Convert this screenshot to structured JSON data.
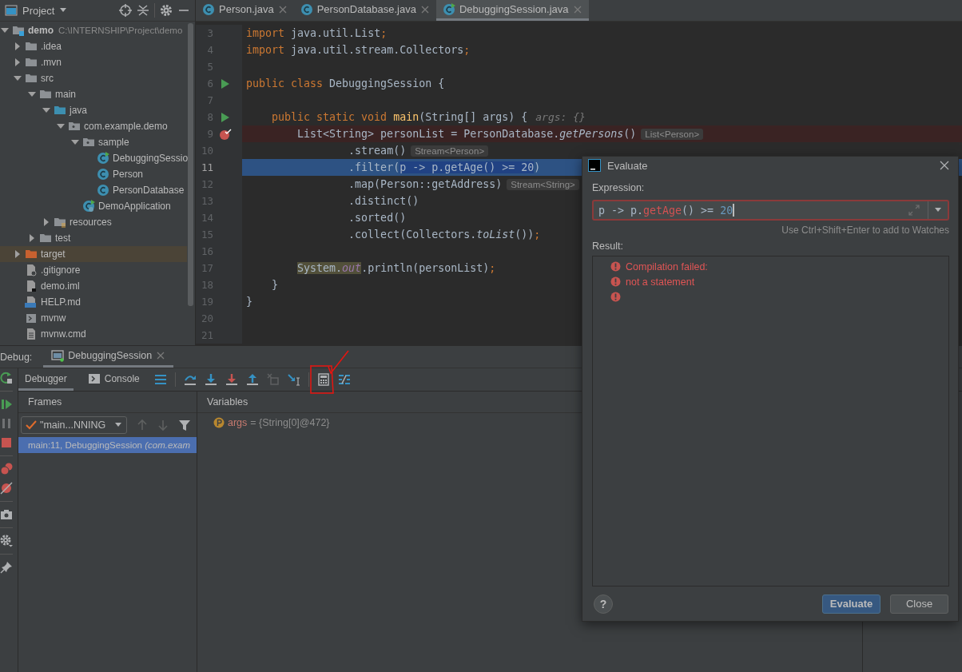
{
  "project_panel": {
    "title": "Project",
    "tree": [
      {
        "name": "demo",
        "path": "C:\\INTERNSHIP\\Project\\demo",
        "kind": "module",
        "expanded": true,
        "selected": false,
        "children": [
          {
            "name": ".idea",
            "kind": "folder",
            "expanded": false,
            "selected": false
          },
          {
            "name": ".mvn",
            "kind": "folder",
            "expanded": false,
            "selected": false
          },
          {
            "name": "src",
            "kind": "folder",
            "expanded": true,
            "selected": false,
            "children": [
              {
                "name": "main",
                "kind": "folder",
                "expanded": true,
                "selected": false,
                "children": [
                  {
                    "name": "java",
                    "kind": "source",
                    "expanded": true,
                    "selected": false,
                    "children": [
                      {
                        "name": "com.example.demo",
                        "kind": "package",
                        "expanded": true,
                        "selected": false,
                        "children": [
                          {
                            "name": "sample",
                            "kind": "package",
                            "expanded": true,
                            "selected": false,
                            "children": [
                              {
                                "name": "DebuggingSessio",
                                "kind": "class-main",
                                "selected": false
                              },
                              {
                                "name": "Person",
                                "kind": "class",
                                "selected": false
                              },
                              {
                                "name": "PersonDatabase",
                                "kind": "class",
                                "selected": false
                              }
                            ]
                          },
                          {
                            "name": "DemoApplication",
                            "kind": "spring",
                            "selected": false
                          }
                        ]
                      }
                    ]
                  },
                  {
                    "name": "resources",
                    "kind": "resources",
                    "expanded": false,
                    "selected": false
                  }
                ]
              },
              {
                "name": "test",
                "kind": "folder",
                "expanded": false,
                "selected": false
              }
            ]
          },
          {
            "name": "target",
            "kind": "excluded",
            "expanded": false,
            "selected": true
          },
          {
            "name": ".gitignore",
            "kind": "ignore",
            "selected": false
          },
          {
            "name": "demo.iml",
            "kind": "iml",
            "selected": false
          },
          {
            "name": "HELP.md",
            "kind": "md",
            "selected": false
          },
          {
            "name": "mvnw",
            "kind": "script",
            "selected": false
          },
          {
            "name": "mvnw.cmd",
            "kind": "text",
            "selected": false
          }
        ]
      }
    ]
  },
  "editor": {
    "tabs": [
      {
        "label": "Person.java",
        "kind": "class",
        "selected": false
      },
      {
        "label": "PersonDatabase.java",
        "kind": "class",
        "selected": false
      },
      {
        "label": "DebuggingSession.java",
        "kind": "class-main",
        "selected": true
      }
    ],
    "lines": [
      {
        "number": "3",
        "tokens": [
          {
            "text": "import",
            "kind": "kw"
          },
          {
            "text": " java.util.List",
            "kind": "p"
          },
          {
            "text": ";",
            "kind": "kw"
          }
        ]
      },
      {
        "number": "4",
        "tokens": [
          {
            "text": "import",
            "kind": "kw"
          },
          {
            "text": " java.util.stream.Collectors",
            "kind": "p"
          },
          {
            "text": ";",
            "kind": "kw"
          }
        ]
      },
      {
        "number": "5"
      },
      {
        "number": "6",
        "marker": {
          "kind": "run"
        },
        "tokens": [
          {
            "text": "public class ",
            "kind": "kw"
          },
          {
            "text": "DebuggingSession {",
            "kind": "p"
          }
        ]
      },
      {
        "number": "7"
      },
      {
        "number": "8",
        "marker": {
          "kind": "run"
        },
        "tokens": [
          {
            "text": "    public static void ",
            "kind": "kw"
          },
          {
            "text": "main",
            "kind": "fn"
          },
          {
            "text": "(String[] args) {",
            "kind": "p"
          }
        ],
        "hint": {
          "text": "args: {}",
          "kind": "value"
        }
      },
      {
        "number": "9",
        "marker": {
          "kind": "breakpoint"
        },
        "highlight": {
          "kind": "breakpoint"
        },
        "tokens": [
          {
            "text": "        List<String> personList = PersonDatabase.",
            "kind": "p"
          },
          {
            "text": "getPersons",
            "kind": "it"
          },
          {
            "text": "()",
            "kind": "p"
          }
        ],
        "hint": {
          "text": "List<Person>",
          "kind": "type"
        }
      },
      {
        "number": "10",
        "tokens": [
          {
            "text": "                .stream()",
            "kind": "p"
          }
        ],
        "hint": {
          "text": "Stream<Person>",
          "kind": "type"
        }
      },
      {
        "number": "11",
        "highlight": {
          "kind": "execution"
        },
        "tokens": [
          {
            "text": "                .filter(",
            "kind": "p"
          },
          {
            "text": "p -> p.getAge() >= 20",
            "kind": "sel"
          },
          {
            "text": ")",
            "kind": "p"
          }
        ]
      },
      {
        "number": "12",
        "tokens": [
          {
            "text": "                .map(Person::getAddress)",
            "kind": "p"
          }
        ],
        "hint": {
          "text": "Stream<String>",
          "kind": "type"
        }
      },
      {
        "number": "13",
        "tokens": [
          {
            "text": "                .distinct()",
            "kind": "p"
          }
        ]
      },
      {
        "number": "14",
        "tokens": [
          {
            "text": "                .sorted()",
            "kind": "p"
          }
        ]
      },
      {
        "number": "15",
        "tokens": [
          {
            "text": "                .collect(Collectors.",
            "kind": "p"
          },
          {
            "text": "toList",
            "kind": "it"
          },
          {
            "text": "())",
            "kind": "p"
          },
          {
            "text": ";",
            "kind": "kw"
          }
        ]
      },
      {
        "number": "16"
      },
      {
        "number": "17",
        "tokens": [
          {
            "text": "        System.",
            "kind": "usage"
          },
          {
            "text": "out",
            "kind": "usagefield"
          },
          {
            "text": ".println(personList)",
            "kind": "p"
          },
          {
            "text": ";",
            "kind": "kw"
          }
        ]
      },
      {
        "number": "18",
        "tokens": [
          {
            "text": "    }",
            "kind": "p"
          }
        ]
      },
      {
        "number": "19",
        "tokens": [
          {
            "text": "}",
            "kind": "p"
          }
        ]
      },
      {
        "number": "20"
      },
      {
        "number": "21"
      }
    ]
  },
  "debug": {
    "label": "Debug:",
    "session_tab": {
      "label": "DebuggingSession",
      "selected": true
    },
    "side_actions": [
      {
        "kind": "rerun",
        "disabled": false
      },
      {
        "kind": "separator"
      },
      {
        "kind": "resume",
        "disabled": false
      },
      {
        "kind": "pause",
        "disabled": true
      },
      {
        "kind": "stop",
        "disabled": false
      },
      {
        "kind": "separator"
      },
      {
        "kind": "breakpoints",
        "disabled": false
      },
      {
        "kind": "mute",
        "disabled": false
      },
      {
        "kind": "separator"
      },
      {
        "kind": "camera",
        "disabled": false
      },
      {
        "kind": "separator"
      },
      {
        "kind": "settings",
        "disabled": false
      },
      {
        "kind": "separator"
      },
      {
        "kind": "pin",
        "disabled": false
      }
    ],
    "tabs": [
      {
        "label": "Debugger",
        "kind": "plain",
        "selected": true
      },
      {
        "label": "Console",
        "kind": "console",
        "selected": false
      }
    ],
    "actions": [
      {
        "kind": "menu",
        "disabled": false
      },
      {
        "kind": "separator"
      },
      {
        "kind": "step-over",
        "disabled": false
      },
      {
        "kind": "step-into",
        "disabled": false
      },
      {
        "kind": "force-step-into",
        "disabled": false
      },
      {
        "kind": "step-out",
        "disabled": false
      },
      {
        "kind": "drop-frame",
        "disabled": true
      },
      {
        "kind": "run-to-cursor",
        "disabled": false
      },
      {
        "kind": "separator"
      },
      {
        "kind": "evaluate",
        "disabled": false
      },
      {
        "kind": "trace",
        "disabled": false
      }
    ],
    "frames": {
      "title": "Frames",
      "thread": "\"main...NNING",
      "items": [
        {
          "text": "main:11, DebuggingSession *(com.exam*",
          "selected": true
        }
      ]
    },
    "variables": {
      "title": "Variables",
      "items": [
        {
          "name": "args",
          "value": "= {String[0]@472}"
        }
      ]
    }
  },
  "evaluate_dialog": {
    "title": "Evaluate",
    "expression_label": "Expression:",
    "expression": [
      {
        "text": "p -> p.",
        "kind": "p"
      },
      {
        "text": "getAge",
        "kind": "error"
      },
      {
        "text": "() >= ",
        "kind": "p"
      },
      {
        "text": "20",
        "kind": "num"
      }
    ],
    "watch_hint": "Use Ctrl+Shift+Enter to add to Watches",
    "result_label": "Result:",
    "results": [
      {
        "kind": "error",
        "text": "Compilation failed:"
      },
      {
        "kind": "error",
        "text": "not a statement"
      },
      {
        "kind": "error"
      }
    ],
    "help": "?",
    "buttons": [
      {
        "label": "Evaluate",
        "kind": "default"
      },
      {
        "label": "Close",
        "kind": "plain"
      }
    ]
  }
}
